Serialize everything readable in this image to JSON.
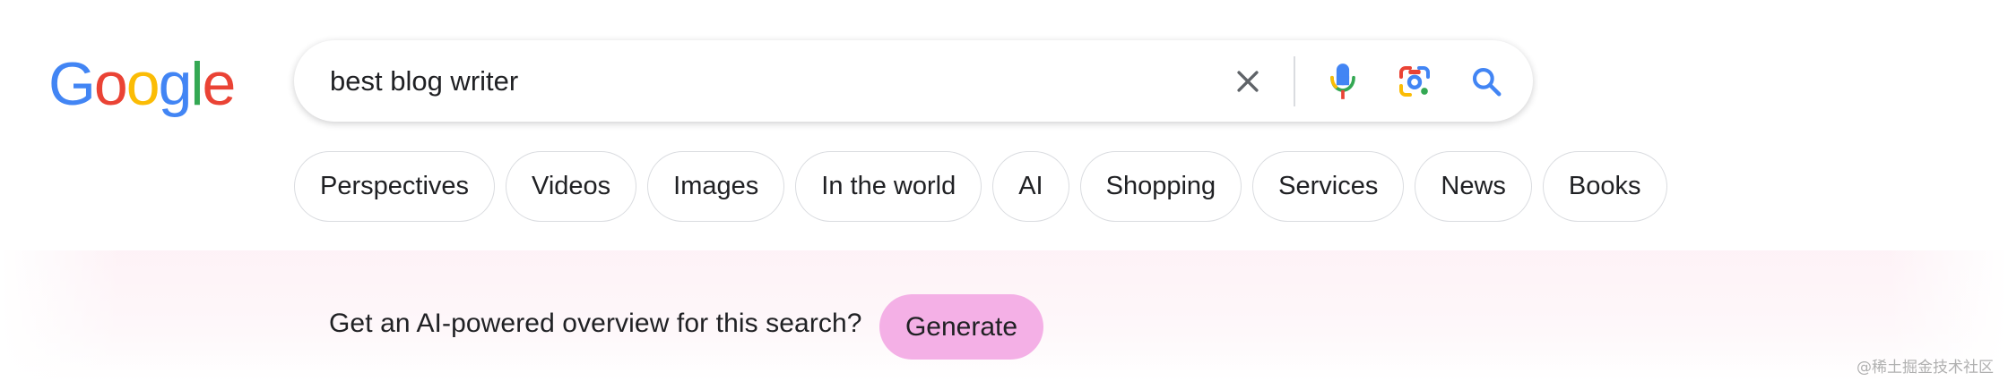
{
  "logo": {
    "text": "Google",
    "letters": [
      {
        "char": "G",
        "color": "#4285F4"
      },
      {
        "char": "o",
        "color": "#EA4335"
      },
      {
        "char": "o",
        "color": "#FBBC05"
      },
      {
        "char": "g",
        "color": "#4285F4"
      },
      {
        "char": "l",
        "color": "#34A853"
      },
      {
        "char": "e",
        "color": "#EA4335"
      }
    ]
  },
  "search": {
    "value": "best blog writer",
    "icons": [
      "close-icon",
      "mic-icon",
      "lens-icon",
      "search-icon"
    ]
  },
  "chips": [
    {
      "label": "Perspectives"
    },
    {
      "label": "Videos"
    },
    {
      "label": "Images"
    },
    {
      "label": "In the world"
    },
    {
      "label": "AI"
    },
    {
      "label": "Shopping"
    },
    {
      "label": "Services"
    },
    {
      "label": "News"
    },
    {
      "label": "Books"
    }
  ],
  "ai_overview": {
    "prompt": "Get an AI-powered overview for this search?",
    "button_label": "Generate",
    "button_color": "#F4B0E6"
  },
  "watermark": "@稀土掘金技术社区"
}
